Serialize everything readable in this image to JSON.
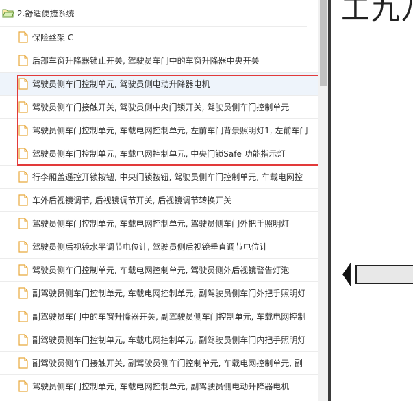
{
  "tree": {
    "root": {
      "label": "2.舒适便捷系统",
      "icon": "folder-icon"
    },
    "items": [
      {
        "label": "保险丝架 C"
      },
      {
        "label": "后部车窗升降器锁止开关, 驾驶员车门中的车窗升降器中央开关"
      },
      {
        "label": "驾驶员侧车门控制单元, 驾驶员侧电动升降器电机",
        "selected": true
      },
      {
        "label": "驾驶员侧车门接触开关, 驾驶员侧中央门锁开关, 驾驶员侧车门控制单元"
      },
      {
        "label": "驾驶员侧车门控制单元, 车载电网控制单元, 左前车门背景照明灯1, 左前车门"
      },
      {
        "label": "驾驶员侧车门控制单元, 车载电网控制单元, 中央门锁Safe 功能指示灯"
      },
      {
        "label": "行李厢盖遥控开锁按钮, 中央门锁按钮, 驾驶员侧车门控制单元, 车载电网控"
      },
      {
        "label": "车外后视镜调节, 后视镜调节开关, 后视镜调节转换开关"
      },
      {
        "label": "驾驶员侧车门控制单元, 车载电网控制单元, 驾驶员侧车门外把手照明灯"
      },
      {
        "label": "驾驶员侧后视镜水平调节电位计, 驾驶员侧后视镜垂直调节电位计"
      },
      {
        "label": "驾驶员侧车门控制单元, 车载电网控制单元, 驾驶员侧外后视镜警告灯泡"
      },
      {
        "label": "副驾驶员侧车门控制单元, 车载电网控制单元, 副驾驶员侧车门外把手照明灯"
      },
      {
        "label": "副驾驶员车门中的车窗升降器开关, 副驾驶员侧车门控制单元, 车载电网控制"
      },
      {
        "label": "副驾驶员侧车门控制单元, 车载电网控制单元, 副驾驶员侧车门内把手照明灯"
      },
      {
        "label": "副驾驶员侧车门接触开关, 副驾驶员侧车门控制单元, 车载电网控制单元, 副"
      },
      {
        "label": "驾驶员侧车门控制单元, 车载电网控制单元, 副驾驶员侧电动升降器电机"
      }
    ]
  },
  "right_panel": {
    "title_fragment": "工九八"
  },
  "colors": {
    "highlight": "#e23a3a",
    "selected_row": "#eef4fb",
    "file_icon": "#e8a93c"
  }
}
